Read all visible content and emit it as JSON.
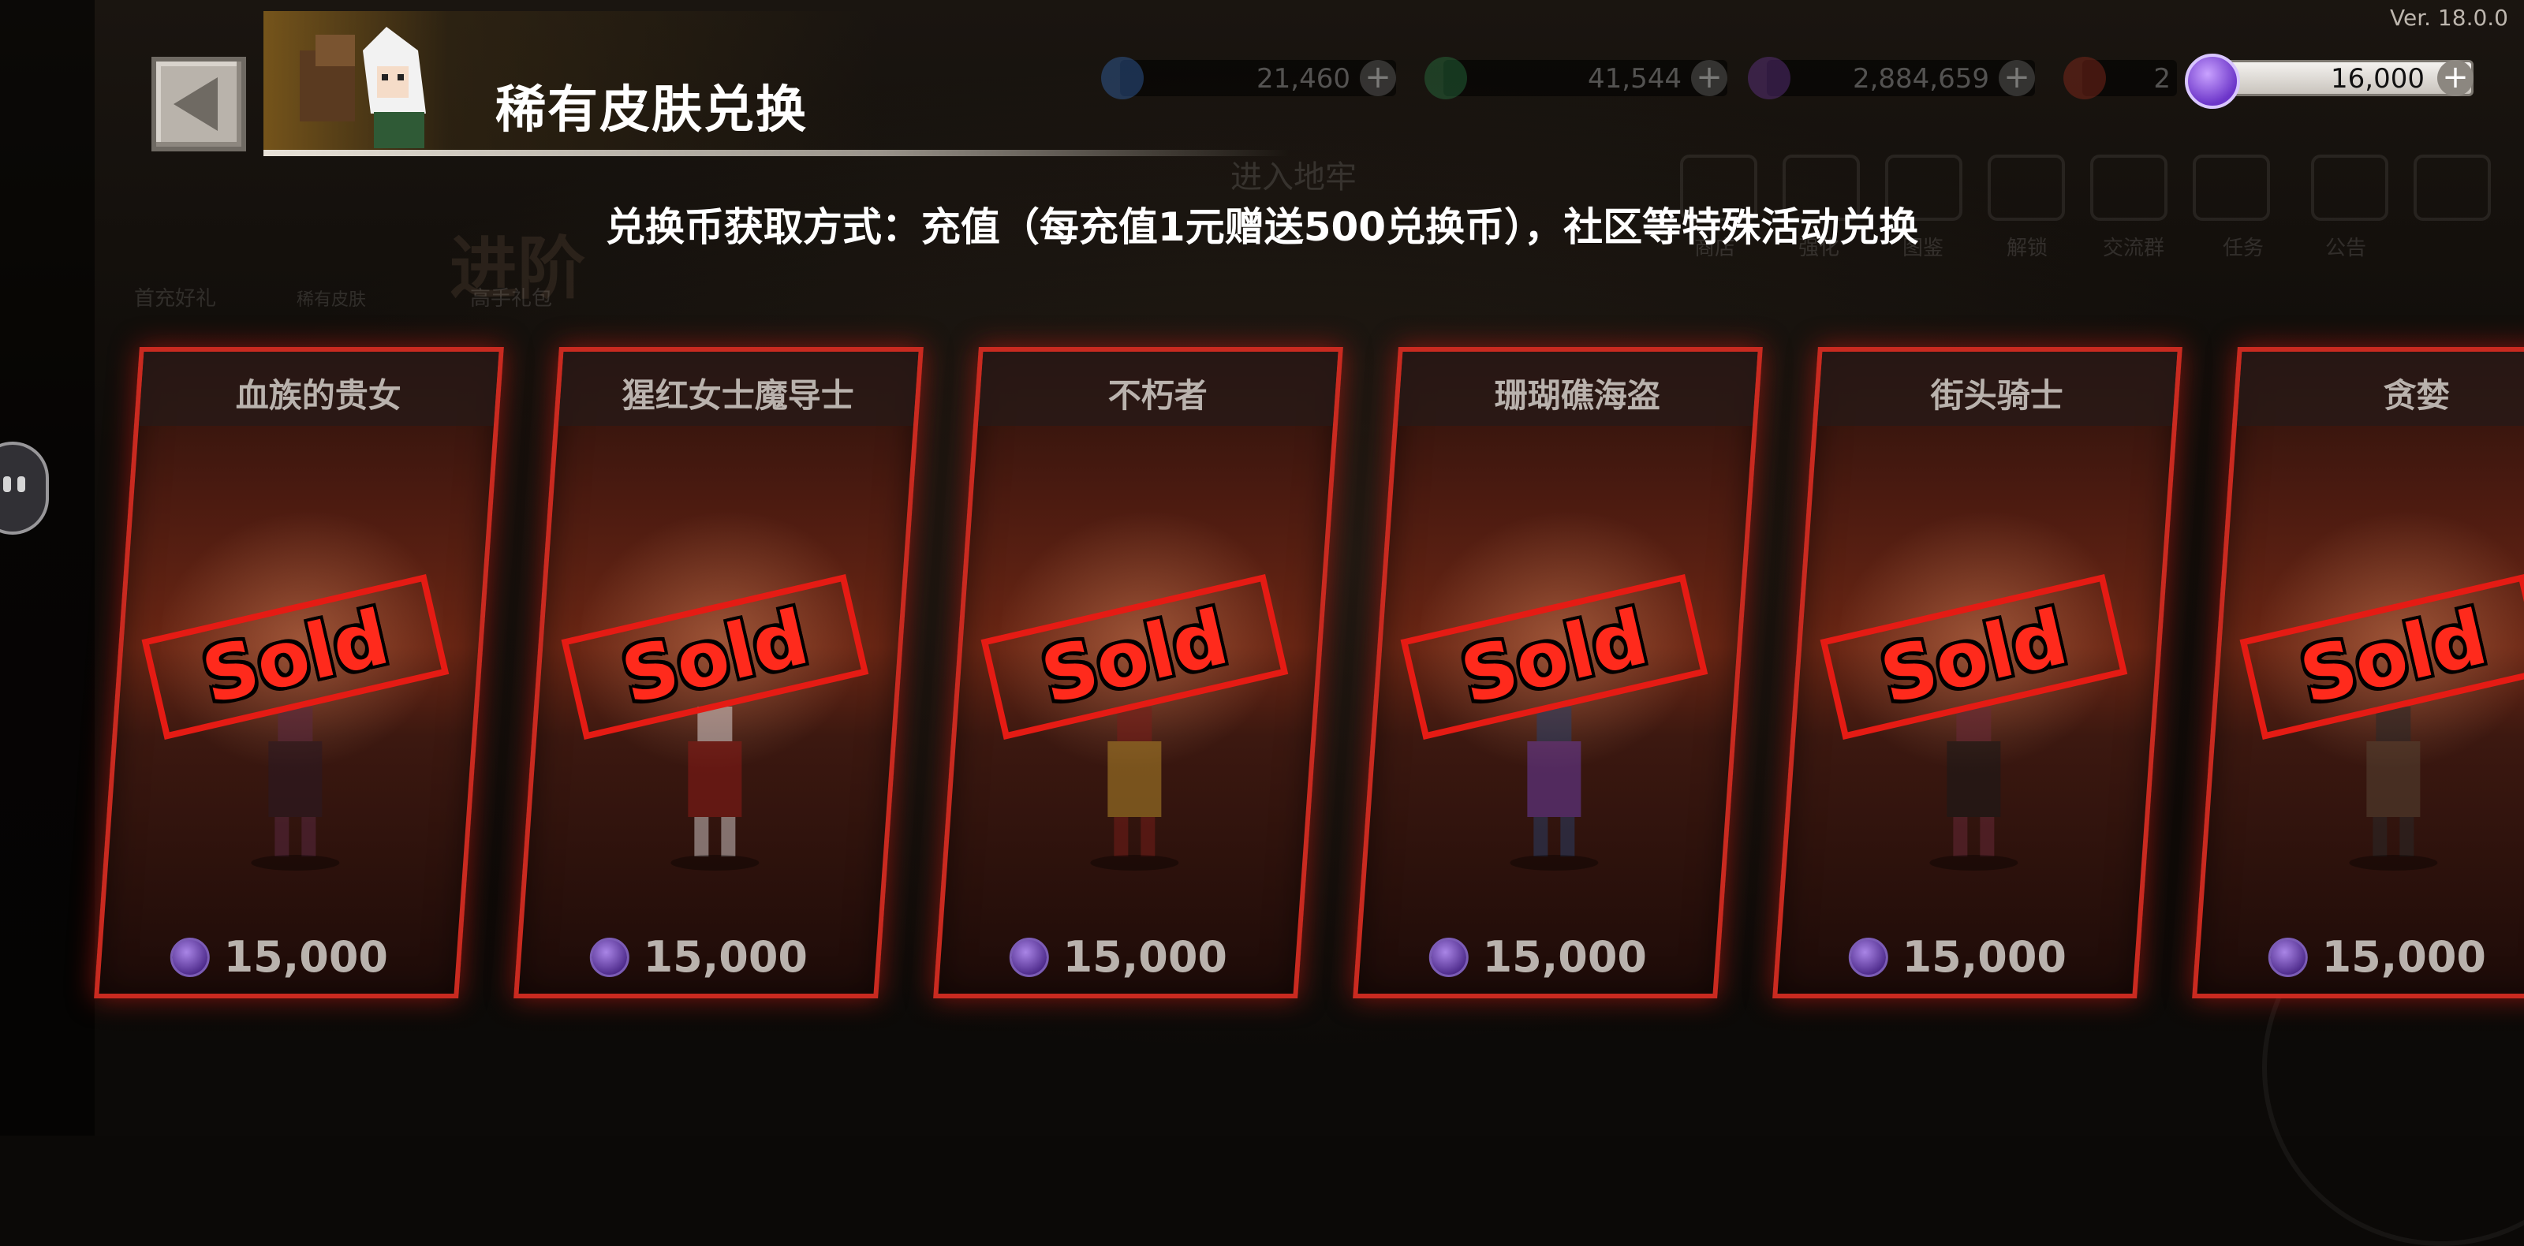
{
  "app": {
    "version": "Ver. 18.0.0",
    "title": "稀有皮肤兑换",
    "subtitle": "兑换币获取方式：充值（每充值1元赠送500兑换币），社区等特殊活动兑换"
  },
  "currencies": [
    {
      "name": "diamond",
      "value": "21,460",
      "icon": "diamond-icon",
      "color": "#3b7bd6"
    },
    {
      "name": "green-gem",
      "value": "41,544",
      "icon": "green-gem-icon",
      "color": "#2f8f4f"
    },
    {
      "name": "purple-crystal",
      "value": "2,884,659",
      "icon": "purple-crystal-icon",
      "color": "#7b3fb0"
    },
    {
      "name": "red-item",
      "value": "2",
      "icon": "red-orb-icon",
      "color": "#8b2a1c"
    },
    {
      "name": "exchange-coin",
      "value": "16,000",
      "icon": "exchange-coin-icon",
      "color": "#8a5ad8"
    }
  ],
  "background": {
    "ghost_labels": [
      "进入地牢",
      "商店",
      "强化",
      "图鉴",
      "解锁",
      "交流群",
      "任务",
      "公告",
      "首充好礼",
      "稀有皮肤",
      "高手礼包",
      "进阶"
    ]
  },
  "cards": [
    {
      "name": "血族的贵女",
      "status": "Sold",
      "price": "15,000"
    },
    {
      "name": "猩红女士魔导士",
      "status": "Sold",
      "price": "15,000"
    },
    {
      "name": "不朽者",
      "status": "Sold",
      "price": "15,000"
    },
    {
      "name": "珊瑚礁海盗",
      "status": "Sold",
      "price": "15,000"
    },
    {
      "name": "街头骑士",
      "status": "Sold",
      "price": "15,000"
    },
    {
      "name": "贪婪",
      "status": "Sold",
      "price": "15,000"
    }
  ],
  "colors": {
    "card_border": "#c92a20",
    "sold_red": "#ff2a1c",
    "coin_purple": "#8a5ad8"
  }
}
